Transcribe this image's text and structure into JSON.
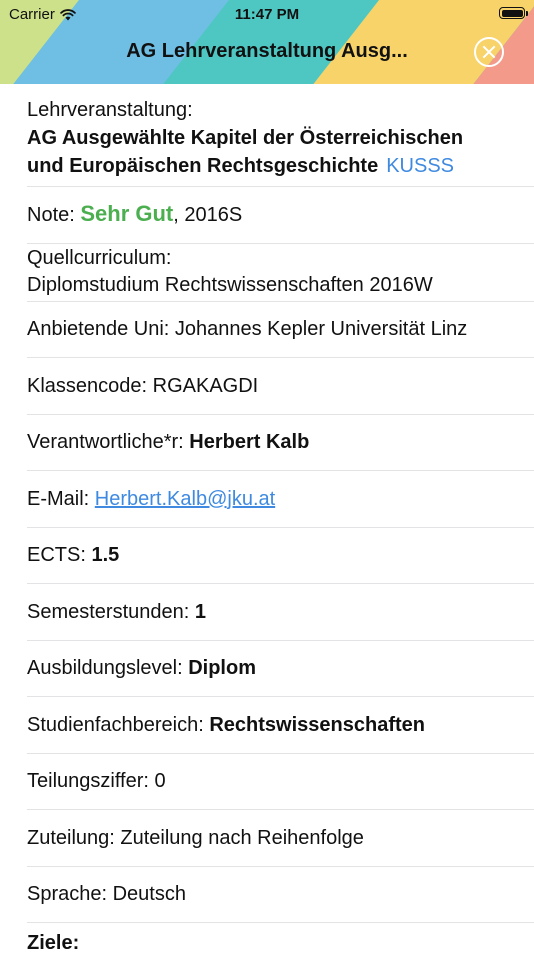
{
  "status_bar": {
    "carrier": "Carrier",
    "time": "11:47 PM"
  },
  "header": {
    "title": "AG Lehrveranstaltung Ausg...",
    "colors": [
      "#cde08a",
      "#6fbfe4",
      "#4ec6c2",
      "#f7d36a",
      "#f39a8a"
    ]
  },
  "course": {
    "label": "Lehrveranstaltung:",
    "name_line1": "AG Ausgewählte Kapitel der Österreichischen",
    "name_line2": "und Europäischen Rechtsgeschichte",
    "link": "KUSSS"
  },
  "grade": {
    "label": "Note: ",
    "value": "Sehr Gut",
    "semester": ", 2016S"
  },
  "curriculum": {
    "label": "Quellcurriculum:",
    "value": "Diplomstudium Rechtswissenschaften 2016W"
  },
  "university": "Anbietende Uni: Johannes Kepler Universität Linz",
  "class_code": "Klassencode: RGAKAGDI",
  "responsible": {
    "label": "Verantwortliche*r: ",
    "value": "Herbert Kalb"
  },
  "email": {
    "label": "E-Mail: ",
    "value": "Herbert.Kalb@jku.at"
  },
  "ects": {
    "label": "ECTS: ",
    "value": "1.5"
  },
  "semester_hours": {
    "label": "Semesterstunden: ",
    "value": "1"
  },
  "education_level": {
    "label": "Ausbildungslevel: ",
    "value": "Diplom"
  },
  "field": {
    "label": "Studienfachbereich: ",
    "value": "Rechtswissenschaften"
  },
  "split_number": "Teilungsziffer: 0",
  "allocation": "Zuteilung: Zuteilung nach Reihenfolge",
  "language": "Sprache: Deutsch",
  "goals_label": "Ziele:"
}
